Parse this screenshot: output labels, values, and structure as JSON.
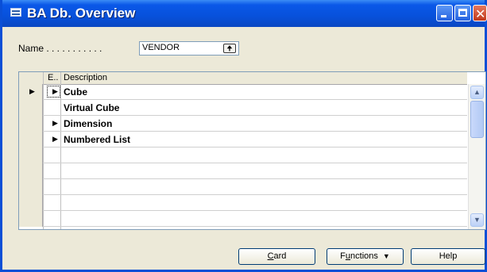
{
  "window": {
    "title": "BA Db. Overview"
  },
  "filter": {
    "label": "Name . . . . . . . . . . .",
    "value": "VENDOR",
    "lookup_glyph": "🠉"
  },
  "grid": {
    "columns": [
      "E..",
      "Description"
    ],
    "rows": [
      {
        "expandable": true,
        "description": "Cube",
        "current": true
      },
      {
        "expandable": false,
        "description": "Virtual Cube",
        "current": false
      },
      {
        "expandable": true,
        "description": "Dimension",
        "current": false
      },
      {
        "expandable": true,
        "description": "Numbered List",
        "current": false
      },
      {
        "expandable": false,
        "description": "",
        "current": false
      },
      {
        "expandable": false,
        "description": "",
        "current": false
      },
      {
        "expandable": false,
        "description": "",
        "current": false
      },
      {
        "expandable": false,
        "description": "",
        "current": false
      },
      {
        "expandable": false,
        "description": "",
        "current": false
      }
    ]
  },
  "buttons": {
    "card": {
      "accel": "C",
      "rest": "ard"
    },
    "functions": {
      "before": "F",
      "accel": "u",
      "rest": "nctions"
    },
    "help": "Help"
  },
  "glyphs": {
    "row_arrow": "▶",
    "scroll_up": "▲",
    "scroll_down": "▼",
    "dropdown": "▼",
    "close": "✕"
  }
}
